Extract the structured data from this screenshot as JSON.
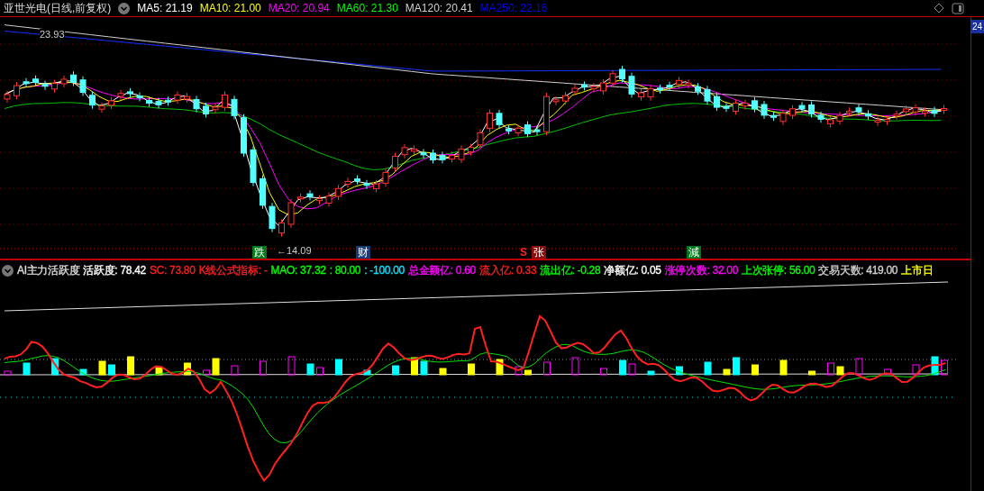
{
  "title": "亚世光电(日线,前复权)",
  "ma_legend": [
    {
      "text": "MA5: 21.19",
      "color": "#ffffff"
    },
    {
      "text": "MA10: 21.00",
      "color": "#ffff00"
    },
    {
      "text": "MA20: 20.94",
      "color": "#ff00ff"
    },
    {
      "text": "MA60: 21.30",
      "color": "#00ff00"
    },
    {
      "text": "MA120: 20.41",
      "color": "#d0d0d0"
    },
    {
      "text": "MA250: 22.16",
      "color": "#0000ff"
    }
  ],
  "price_axis_label": "24",
  "high_label": "23.93",
  "low_label": "←14.09",
  "markers": [
    {
      "text": "跌",
      "color": "#007a1a"
    },
    {
      "text": "财",
      "color": "#173a78"
    },
    {
      "text": "S",
      "color": "#ff2020"
    },
    {
      "text": "张",
      "color": "#8a0c0c"
    },
    {
      "text": "減",
      "color": "#007a1a"
    }
  ],
  "indicator": {
    "name": "AI主力活跃度",
    "legend": [
      {
        "text": "活跃度: 78.42",
        "color": "#ffffff"
      },
      {
        "text": "SC: 73.80",
        "color": "#ff2020"
      },
      {
        "text": "K线公式指标: -",
        "color": "#ff2020"
      },
      {
        "text": "MAO: 37.32",
        "color": "#00ff00"
      },
      {
        "text": ": 80.00",
        "color": "#00ff00"
      },
      {
        "text": ": -100.00",
        "color": "#00e5ff"
      },
      {
        "text": "总金额亿: 0.60",
        "color": "#ff00ff"
      },
      {
        "text": "流入亿: 0.33",
        "color": "#ff2020"
      },
      {
        "text": "流出亿: -0.28",
        "color": "#00ff00"
      },
      {
        "text": "净额亿: 0.05",
        "color": "#ffffff"
      },
      {
        "text": "涨停次数: 32.00",
        "color": "#ff00ff"
      },
      {
        "text": "上次张停: 56.00",
        "color": "#00ff00"
      },
      {
        "text": "交易天数: 419.00",
        "color": "#d0d0d0"
      },
      {
        "text": "上市日",
        "color": "#ffff00"
      }
    ]
  }
}
